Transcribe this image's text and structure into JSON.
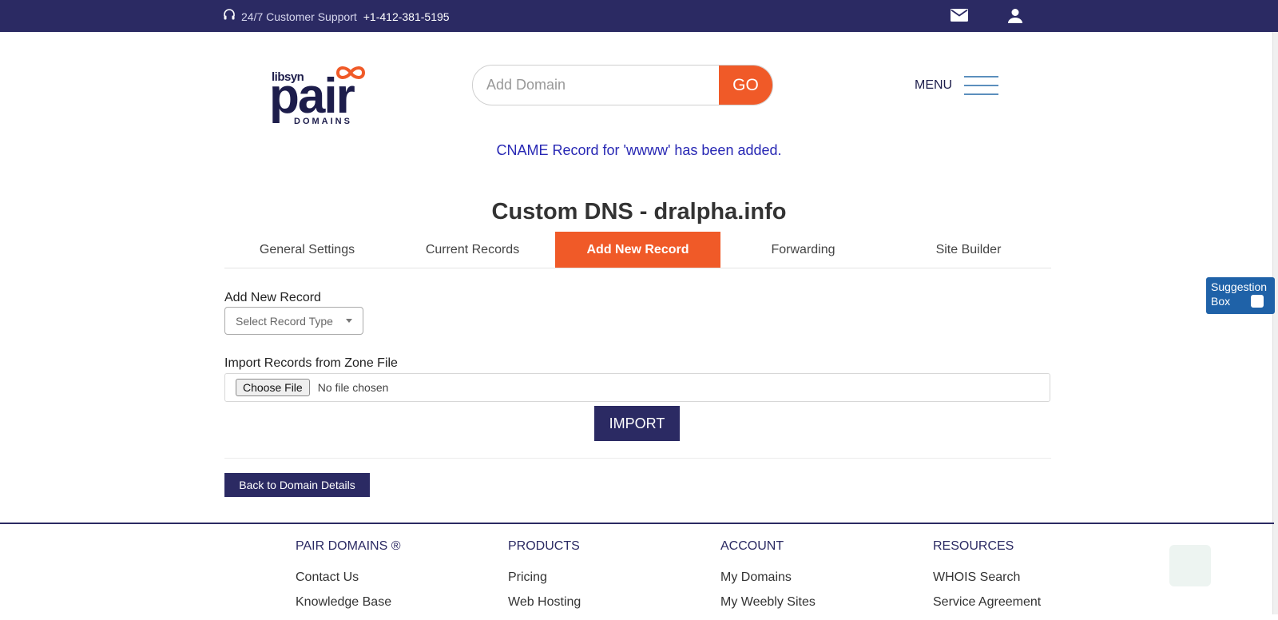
{
  "topbar": {
    "support_label": "24/7 Customer Support",
    "phone": "+1-412-381-5195",
    "icons": [
      "headset-icon",
      "mail-icon",
      "user-icon"
    ]
  },
  "logo": {
    "sub": "libsyn",
    "main": "pair",
    "tag": "DOMAINS"
  },
  "search": {
    "placeholder": "Add Domain",
    "button": "GO"
  },
  "menu": {
    "label": "MENU"
  },
  "message": "CNAME Record for 'wwww' has been added.",
  "page_title": "Custom DNS - dralpha.info",
  "tabs": [
    {
      "label": "General Settings",
      "active": false
    },
    {
      "label": "Current Records",
      "active": false
    },
    {
      "label": "Add New Record",
      "active": true
    },
    {
      "label": "Forwarding",
      "active": false
    },
    {
      "label": "Site Builder",
      "active": false
    }
  ],
  "add_record": {
    "label": "Add New Record",
    "select_placeholder": "Select Record Type"
  },
  "import": {
    "label": "Import Records from Zone File",
    "choose_button": "Choose File",
    "no_file": "No file chosen",
    "submit": "IMPORT"
  },
  "back_button": "Back to Domain Details",
  "suggestion": {
    "line1": "Suggestion",
    "line2": "Box"
  },
  "footer": {
    "columns": [
      {
        "heading": "PAIR DOMAINS ®",
        "links": [
          "Contact Us",
          "Knowledge Base"
        ]
      },
      {
        "heading": "PRODUCTS",
        "links": [
          "Pricing",
          "Web Hosting"
        ]
      },
      {
        "heading": "ACCOUNT",
        "links": [
          "My Domains",
          "My Weebly Sites"
        ]
      },
      {
        "heading": "RESOURCES",
        "links": [
          "WHOIS Search",
          "Service Agreement"
        ]
      }
    ]
  },
  "colors": {
    "navy": "#2b2a63",
    "orange": "#f05a28",
    "message_blue": "#2828b4",
    "suggest_blue": "#1f62a8"
  }
}
